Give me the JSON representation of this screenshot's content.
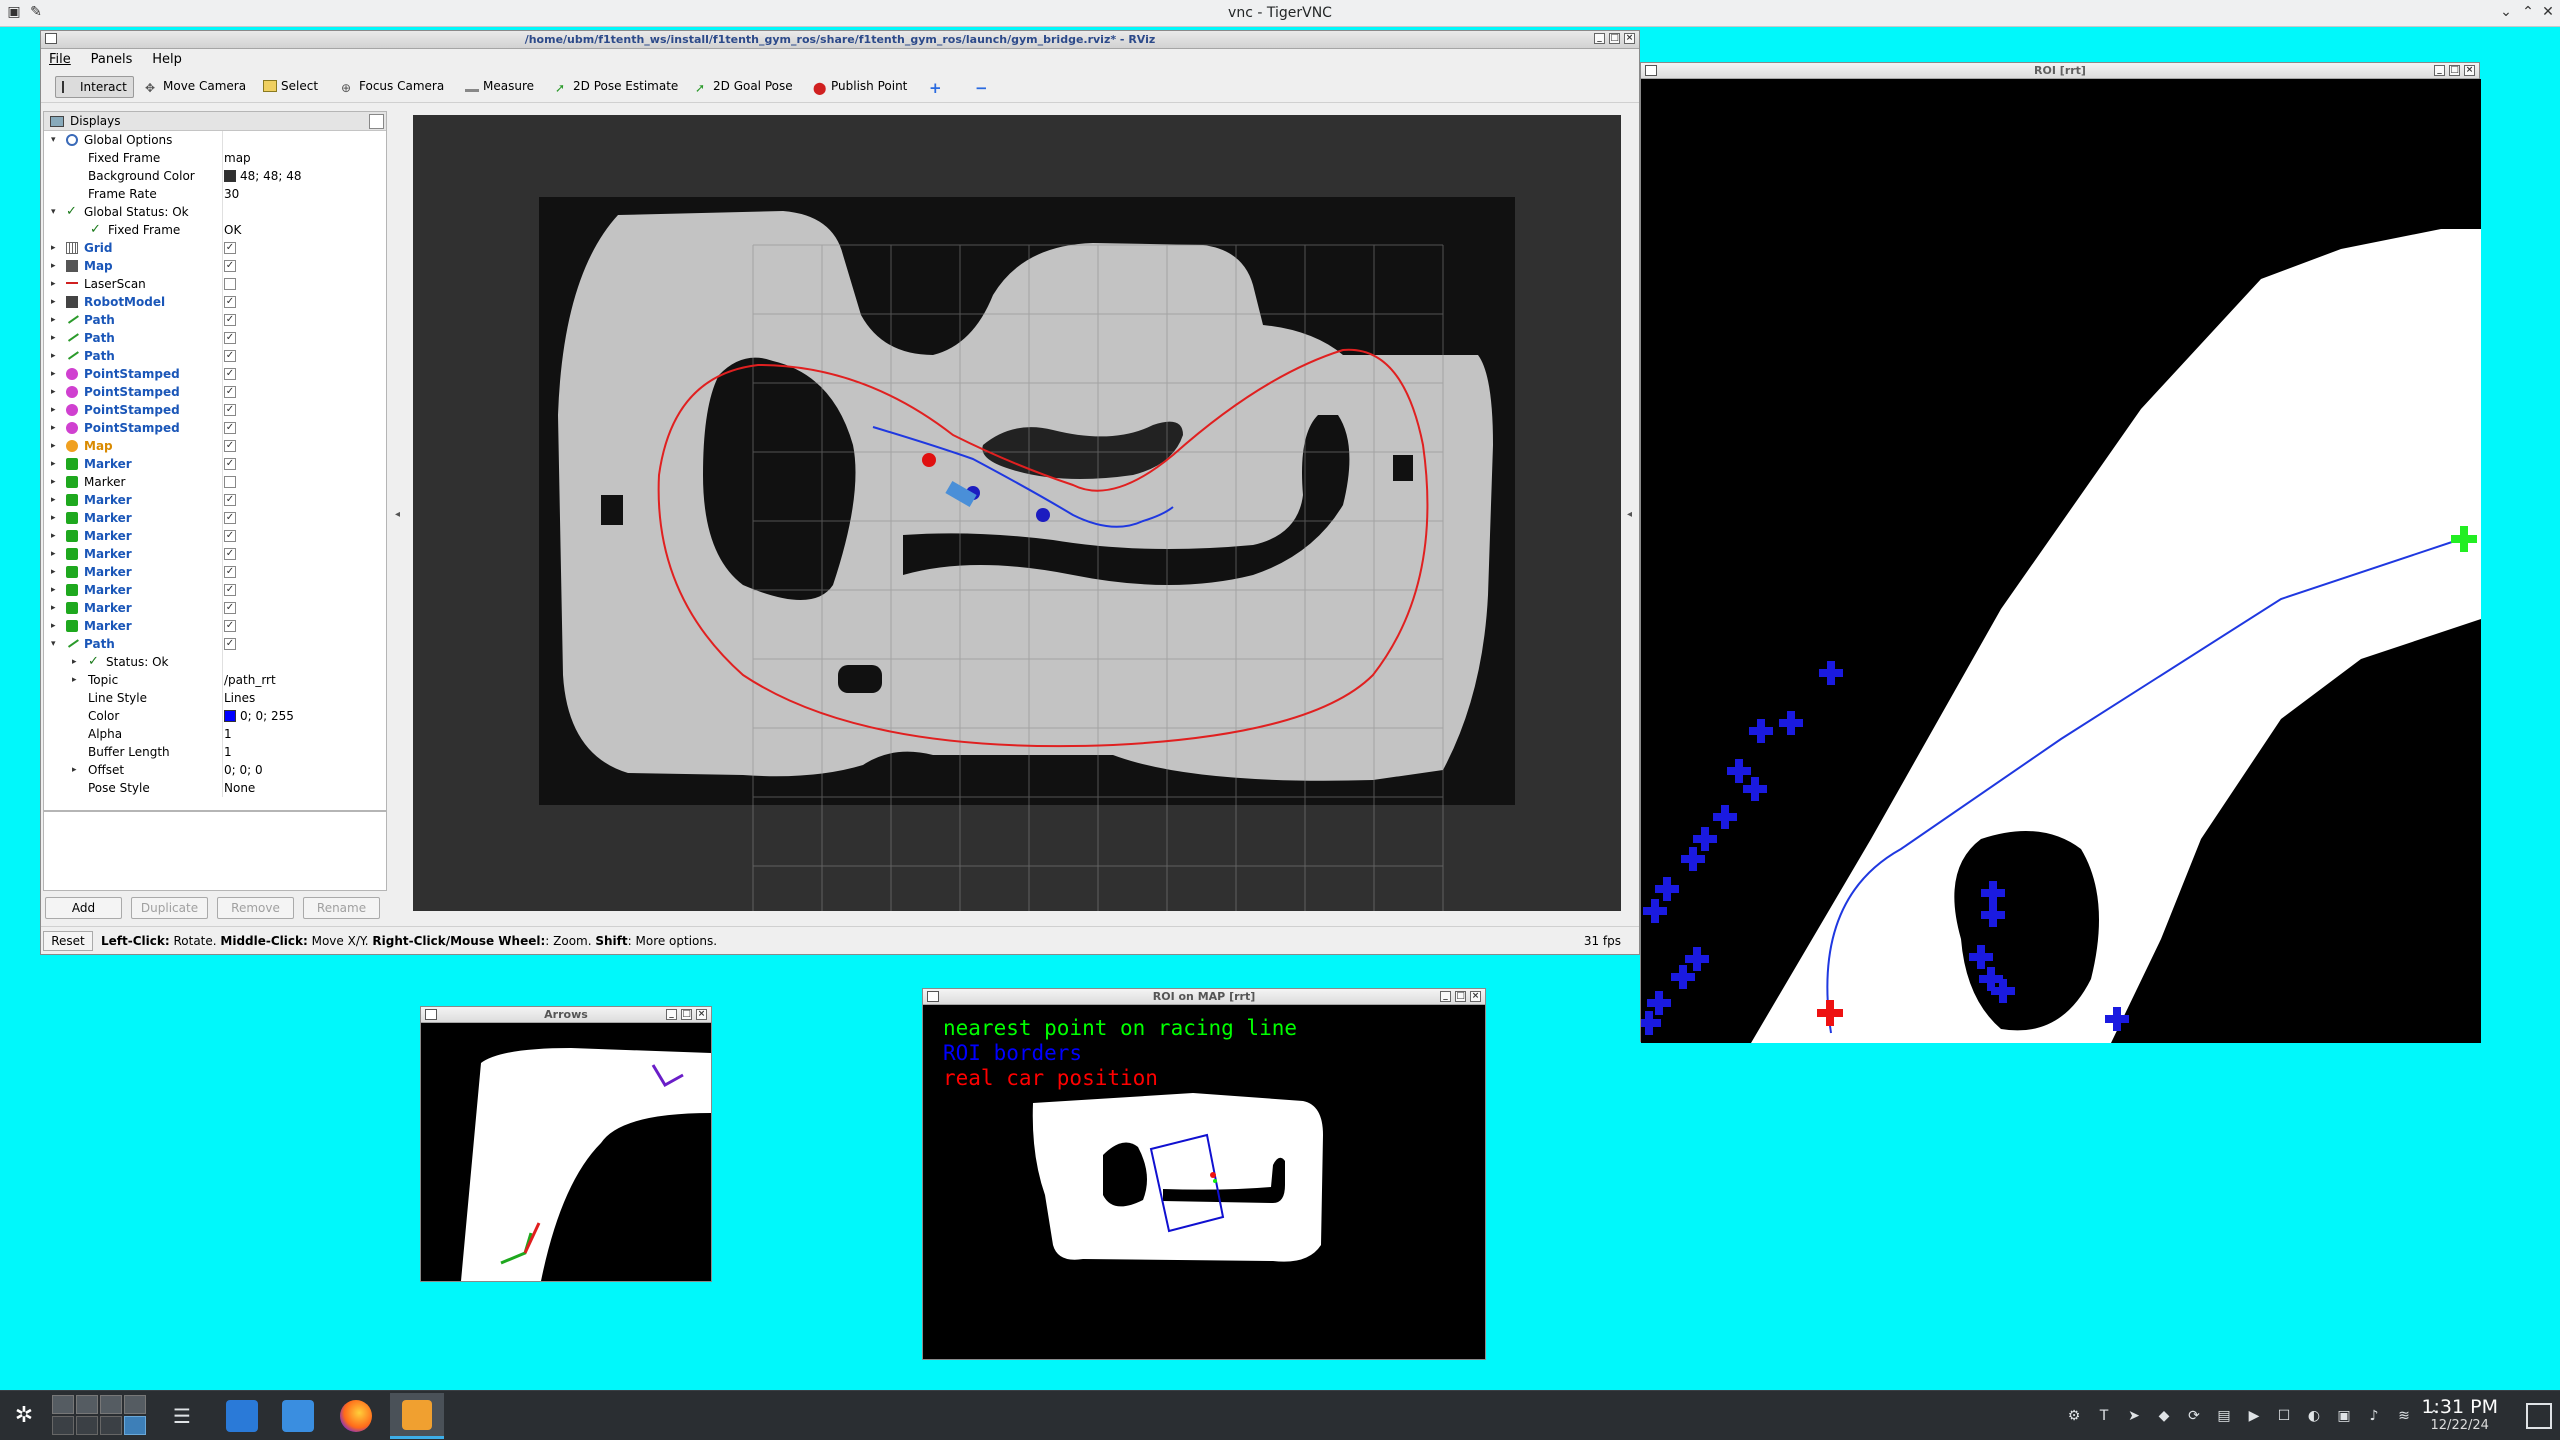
{
  "vnc": {
    "title": "vnc - TigerVNC"
  },
  "rviz": {
    "title": "/home/ubm/f1tenth_ws/install/f1tenth_gym_ros/share/f1tenth_gym_ros/launch/gym_bridge.rviz* - RViz",
    "menu": [
      "File",
      "Panels",
      "Help"
    ],
    "tools": [
      "Interact",
      "Move Camera",
      "Select",
      "Focus Camera",
      "Measure",
      "2D Pose Estimate",
      "2D Goal Pose",
      "Publish Point"
    ],
    "displays_title": "Displays",
    "tree": [
      {
        "label": "Global Options",
        "value": "",
        "expanded": true,
        "icon": "gear-icon",
        "style": "normal"
      },
      {
        "label": "Fixed Frame",
        "value": "map",
        "child": true
      },
      {
        "label": "Background Color",
        "value": "48; 48; 48",
        "child": true,
        "swatch": "#303030"
      },
      {
        "label": "Frame Rate",
        "value": "30",
        "child": true
      },
      {
        "label": "Global Status: Ok",
        "value": "",
        "expanded": true,
        "icon": "check-icon"
      },
      {
        "label": "Fixed Frame",
        "value": "OK",
        "child2": true,
        "icon": "check-icon"
      },
      {
        "label": "Grid",
        "check": true,
        "icon": "grid-icon",
        "style": "blue"
      },
      {
        "label": "Map",
        "check": true,
        "icon": "map-icon",
        "style": "blue"
      },
      {
        "label": "LaserScan",
        "check": false,
        "icon": "laser-icon",
        "style": "normal"
      },
      {
        "label": "RobotModel",
        "check": true,
        "icon": "robot-icon",
        "style": "blue"
      },
      {
        "label": "Path",
        "check": true,
        "icon": "path-icon",
        "style": "blue"
      },
      {
        "label": "Path",
        "check": true,
        "icon": "path-icon",
        "style": "blue"
      },
      {
        "label": "Path",
        "check": true,
        "icon": "path-icon",
        "style": "blue"
      },
      {
        "label": "PointStamped",
        "check": true,
        "icon": "point-icon",
        "style": "blue"
      },
      {
        "label": "PointStamped",
        "check": true,
        "icon": "point-icon",
        "style": "blue"
      },
      {
        "label": "PointStamped",
        "check": true,
        "icon": "point-icon",
        "style": "blue"
      },
      {
        "label": "PointStamped",
        "check": true,
        "icon": "point-icon",
        "style": "blue"
      },
      {
        "label": "Map",
        "check": true,
        "icon": "warning-icon",
        "style": "orange"
      },
      {
        "label": "Marker",
        "check": true,
        "icon": "marker-icon",
        "style": "blue"
      },
      {
        "label": "Marker",
        "check": false,
        "icon": "marker-icon",
        "style": "normal"
      },
      {
        "label": "Marker",
        "check": true,
        "icon": "marker-icon",
        "style": "blue"
      },
      {
        "label": "Marker",
        "check": true,
        "icon": "marker-icon",
        "style": "blue"
      },
      {
        "label": "Marker",
        "check": true,
        "icon": "marker-icon",
        "style": "blue"
      },
      {
        "label": "Marker",
        "check": true,
        "icon": "marker-icon",
        "style": "blue"
      },
      {
        "label": "Marker",
        "check": true,
        "icon": "marker-icon",
        "style": "blue"
      },
      {
        "label": "Marker",
        "check": true,
        "icon": "marker-icon",
        "style": "blue"
      },
      {
        "label": "Marker",
        "check": true,
        "icon": "marker-icon",
        "style": "blue"
      },
      {
        "label": "Marker",
        "check": true,
        "icon": "marker-icon",
        "style": "blue"
      },
      {
        "label": "Path",
        "check": true,
        "icon": "path-icon",
        "style": "blue",
        "expanded": true
      },
      {
        "label": "Status: Ok",
        "value": "",
        "child": true,
        "icon": "check-icon",
        "collapsed": true
      },
      {
        "label": "Topic",
        "value": "/path_rrt",
        "child": true,
        "collapsed": true
      },
      {
        "label": "Line Style",
        "value": "Lines",
        "child": true
      },
      {
        "label": "Color",
        "value": "0; 0; 255",
        "child": true,
        "swatch": "#0000ff"
      },
      {
        "label": "Alpha",
        "value": "1",
        "child": true
      },
      {
        "label": "Buffer Length",
        "value": "1",
        "child": true
      },
      {
        "label": "Offset",
        "value": "0; 0; 0",
        "child": true,
        "collapsed": true
      },
      {
        "label": "Pose Style",
        "value": "None",
        "child": true
      }
    ],
    "buttons": {
      "add": "Add",
      "duplicate": "Duplicate",
      "remove": "Remove",
      "rename": "Rename"
    },
    "status": {
      "reset": "Reset",
      "hint_parts": [
        {
          "b": "Left-Click:",
          "t": " Rotate. "
        },
        {
          "b": "Middle-Click:",
          "t": " Move X/Y. "
        },
        {
          "b": "Right-Click/Mouse Wheel:",
          "t": ": Zoom. "
        },
        {
          "b": "Shift",
          "t": ": More options."
        }
      ],
      "fps": "31 fps"
    }
  },
  "roi": {
    "title": "ROI [rrt]"
  },
  "arrows": {
    "title": "Arrows"
  },
  "roimap": {
    "title": "ROI on MAP [rrt]",
    "legend": [
      {
        "text": "nearest point on racing line",
        "color": "#00ff00"
      },
      {
        "text": "ROI borders",
        "color": "#0000ff"
      },
      {
        "text": "real car position",
        "color": "#ff0000"
      }
    ]
  },
  "taskbar": {
    "time": "1:31 PM",
    "date": "12/22/24"
  },
  "colors": {
    "cyan_bg": "#00f8fb",
    "rviz_bg": "#303030",
    "map_free": "#c3c3c3",
    "map_occupied": "#111111",
    "racing_line": "#e02020",
    "rrt_path": "#1f38e0"
  }
}
